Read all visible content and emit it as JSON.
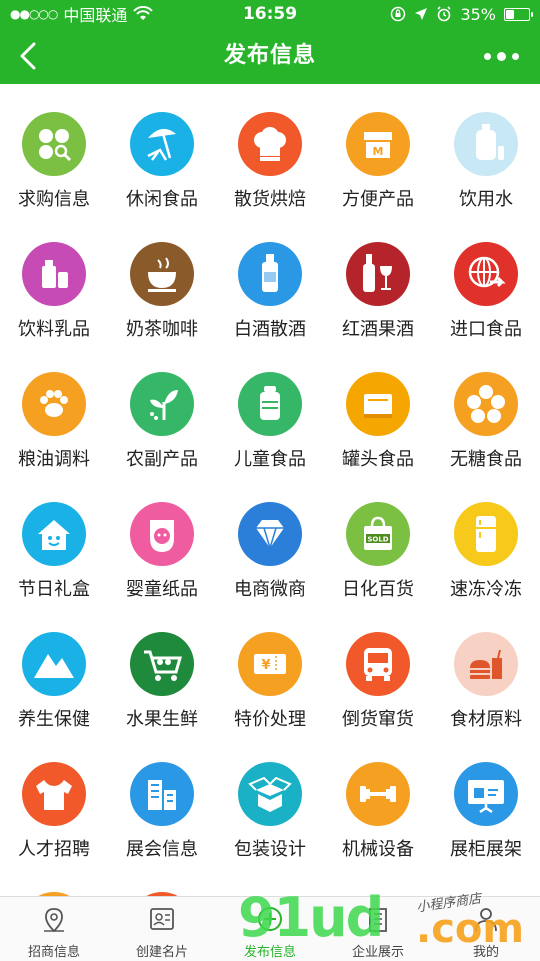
{
  "status_bar": {
    "carrier": "中国联通",
    "time": "16:59",
    "battery": "35%",
    "battery_level": 0.35
  },
  "navbar": {
    "title": "发布信息"
  },
  "categories": [
    {
      "label": "求购信息",
      "color": "#7cc043",
      "icon": "four-circles-search-icon"
    },
    {
      "label": "休闲食品",
      "color": "#1ab1e6",
      "icon": "beach-umbrella-chair-icon"
    },
    {
      "label": "散货烘焙",
      "color": "#f1592a",
      "icon": "chef-hat-icon"
    },
    {
      "label": "方便产品",
      "color": "#f6a021",
      "icon": "convenience-store-icon"
    },
    {
      "label": "饮用水",
      "color": "#c9e8f5",
      "icon": "water-bottle-icon"
    },
    {
      "label": "饮料乳品",
      "color": "#c74bb5",
      "icon": "milk-bottles-icon"
    },
    {
      "label": "奶茶咖啡",
      "color": "#8b5a2b",
      "icon": "tea-cup-icon"
    },
    {
      "label": "白酒散酒",
      "color": "#2b98e6",
      "icon": "liquor-bottle-icon"
    },
    {
      "label": "红酒果酒",
      "color": "#b4242a",
      "icon": "wine-bottle-glass-icon"
    },
    {
      "label": "进口食品",
      "color": "#e0322a",
      "icon": "globe-arrow-icon"
    },
    {
      "label": "粮油调料",
      "color": "#f6a021",
      "icon": "paw-icon"
    },
    {
      "label": "农副产品",
      "color": "#36b768",
      "icon": "sprout-icon"
    },
    {
      "label": "儿童食品",
      "color": "#36b768",
      "icon": "baby-bottle-icon"
    },
    {
      "label": "罐头食品",
      "color": "#f6a600",
      "icon": "book-can-icon"
    },
    {
      "label": "无糖食品",
      "color": "#f6a021",
      "icon": "flower-icon"
    },
    {
      "label": "节日礼盒",
      "color": "#1ab1e6",
      "icon": "house-smile-icon"
    },
    {
      "label": "婴童纸品",
      "color": "#f05ca0",
      "icon": "baby-bib-icon"
    },
    {
      "label": "电商微商",
      "color": "#2b7fd8",
      "icon": "diamond-icon"
    },
    {
      "label": "日化百货",
      "color": "#7cc043",
      "icon": "sold-bag-icon"
    },
    {
      "label": "速冻冷冻",
      "color": "#f6c91a",
      "icon": "refrigerator-icon"
    },
    {
      "label": "养生保健",
      "color": "#1ab1e6",
      "icon": "mountains-icon"
    },
    {
      "label": "水果生鲜",
      "color": "#1f8a3b",
      "icon": "shopping-cart-icon"
    },
    {
      "label": "特价处理",
      "color": "#f6a021",
      "icon": "yen-ticket-icon"
    },
    {
      "label": "倒货窜货",
      "color": "#f1592a",
      "icon": "truck-front-icon"
    },
    {
      "label": "食材原料",
      "color": "#f7d2c4",
      "icon": "burger-drink-icon"
    },
    {
      "label": "人才招聘",
      "color": "#f1592a",
      "icon": "tshirt-icon"
    },
    {
      "label": "展会信息",
      "color": "#2b98e6",
      "icon": "buildings-icon"
    },
    {
      "label": "包装设计",
      "color": "#1ab1c6",
      "icon": "open-box-icon"
    },
    {
      "label": "机械设备",
      "color": "#f6a021",
      "icon": "dumbbell-icon"
    },
    {
      "label": "展柜展架",
      "color": "#2b98e6",
      "icon": "presentation-board-icon"
    }
  ],
  "tabs": [
    {
      "label": "招商信息",
      "icon": "location-pin-icon",
      "active": false
    },
    {
      "label": "创建名片",
      "icon": "id-card-icon",
      "active": false
    },
    {
      "label": "发布信息",
      "icon": "plus-circle-icon",
      "active": true
    },
    {
      "label": "企业展示",
      "icon": "building-icon",
      "active": false
    },
    {
      "label": "我的",
      "icon": "user-icon",
      "active": false
    }
  ],
  "watermark": {
    "main": "91ud",
    "com": ".com",
    "small": "小程序商店"
  },
  "colors": {
    "brand_green": "#27b32a",
    "text": "#222222"
  }
}
